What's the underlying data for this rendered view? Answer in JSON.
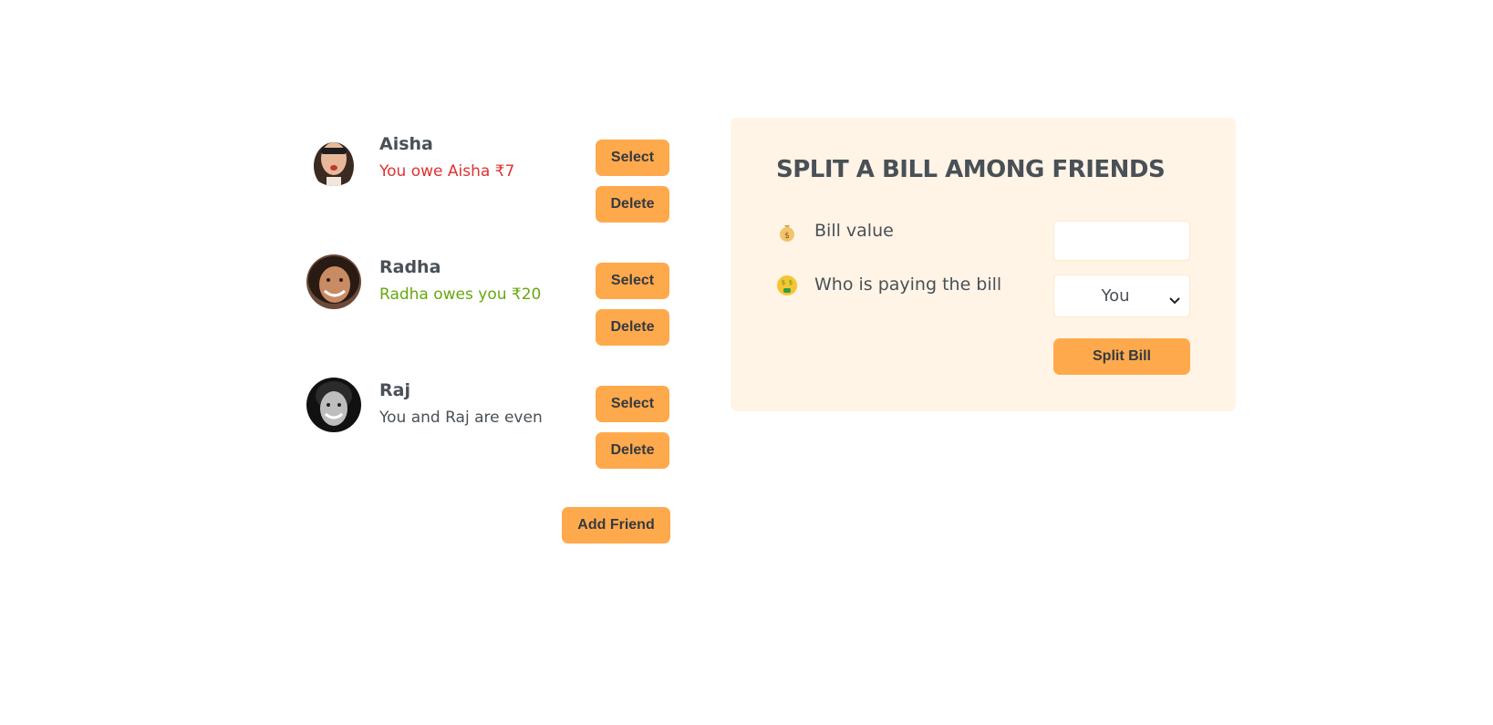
{
  "friends": [
    {
      "name": "Aisha",
      "status": "You owe Aisha ₹7",
      "status_type": "owe",
      "select_label": "Select",
      "delete_label": "Delete"
    },
    {
      "name": "Radha",
      "status": "Radha owes you ₹20",
      "status_type": "owed",
      "select_label": "Select",
      "delete_label": "Delete"
    },
    {
      "name": "Raj",
      "status": "You and Raj are even",
      "status_type": "even",
      "select_label": "Select",
      "delete_label": "Delete"
    }
  ],
  "add_friend_label": "Add Friend",
  "split": {
    "title": "SPLIT A BILL AMONG FRIENDS",
    "bill_value_label": "Bill value",
    "bill_value_icon": "money-bag-icon",
    "bill_value": "",
    "payer_label": "Who is paying the bill",
    "payer_icon": "money-mouth-face-icon",
    "payer_selected": "You",
    "submit_label": "Split Bill"
  },
  "colors": {
    "accent": "#ffa94d",
    "form_bg": "#fff4e6",
    "owe_red": "#e03131",
    "owed_green": "#66a80f",
    "text": "#495057"
  }
}
